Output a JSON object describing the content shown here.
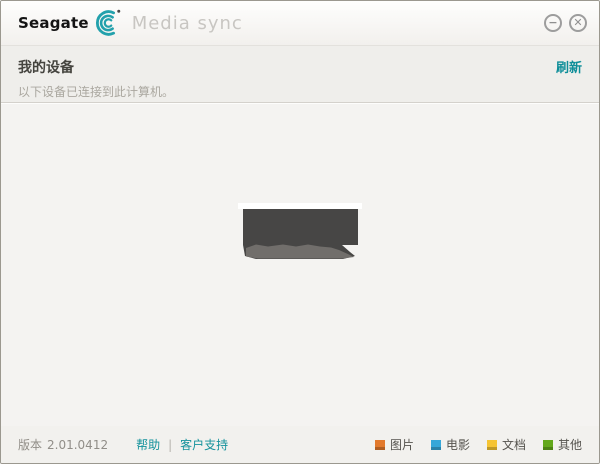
{
  "window": {
    "brand": "Seagate",
    "app_title": "Media sync",
    "controls": {
      "minimize_glyph": "−",
      "close_glyph": "✕"
    }
  },
  "header": {
    "title": "我的设备",
    "subtitle": "以下设备已连接到此计算机。",
    "refresh_label": "刷新"
  },
  "footer": {
    "version_label": "版本",
    "version_value": "2.01.0412",
    "help_label": "帮助",
    "separator": "|",
    "support_label": "客户支持",
    "legend": [
      {
        "label": "图片",
        "color": "#e2792c"
      },
      {
        "label": "电影",
        "color": "#36a7d9"
      },
      {
        "label": "文档",
        "color": "#f5c433"
      },
      {
        "label": "其他",
        "color": "#63a81b"
      }
    ]
  },
  "colors": {
    "accent_teal": "#14929c",
    "logo_teal": "#23a1ac",
    "header_bg": "#efeeeb",
    "main_bg": "#f4f3f1"
  }
}
